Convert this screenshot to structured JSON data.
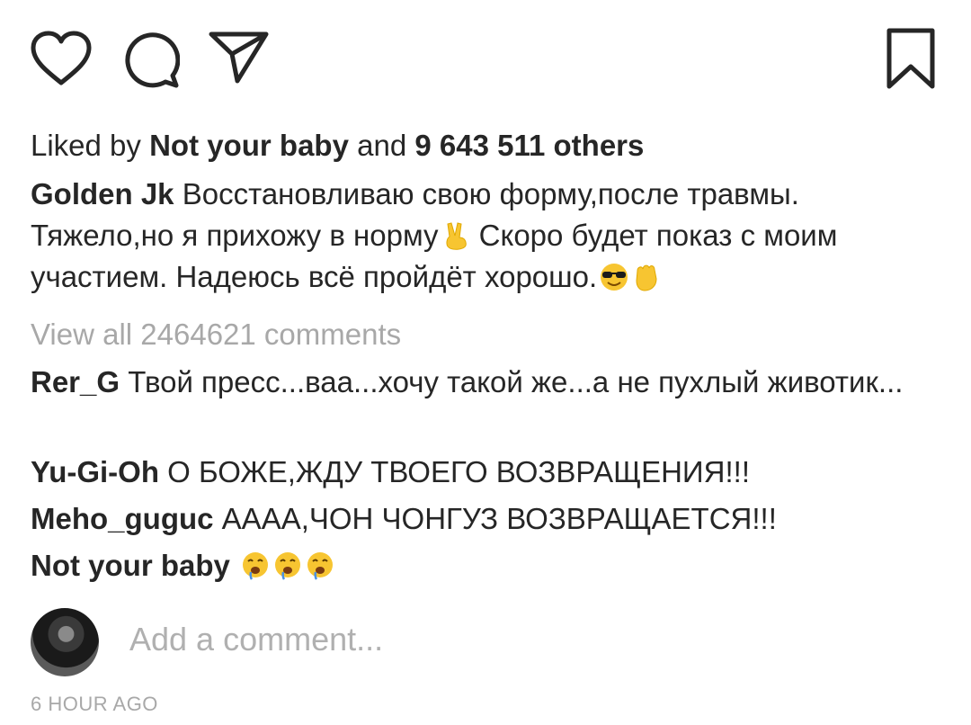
{
  "actions": {
    "like_icon": "heart-icon",
    "comment_icon": "speech-bubble-icon",
    "share_icon": "paper-plane-icon",
    "save_icon": "bookmark-icon"
  },
  "likes": {
    "prefix": "Liked by ",
    "user": "Not your baby",
    "middle": " and ",
    "count": "9 643 511 others"
  },
  "caption": {
    "author": "Golden Jk",
    "text_part1": " Восстановливаю свою форму,после травмы. Тяжело,но я прихожу в норму",
    "emoji1": "victory-hand",
    "text_part2": " Скоро будет показ с моим участием. Надеюсь всё пройдёт хорошо.",
    "emoji2": "sunglasses-face",
    "emoji3": "raised-fist"
  },
  "view_all": "View all 2464621 comments",
  "comments": [
    {
      "user": "Rer_G",
      "text": " Твой пресс...ваа...хочу такой же...а не пухлый животик..."
    },
    {
      "user": "Yu-Gi-Oh",
      "text": " О БОЖЕ,ЖДУ ТВОЕГО ВОЗВРАЩЕНИЯ!!!"
    },
    {
      "user": "Meho_guguc",
      "text": " АААА,ЧОН ЧОНГУЗ ВОЗВРАЩАЕТСЯ!!!"
    },
    {
      "user": "Not your baby",
      "text": " ",
      "emojis": [
        "drooling-face",
        "drooling-face",
        "drooling-face"
      ]
    }
  ],
  "add_comment": {
    "placeholder": "Add a comment..."
  },
  "timestamp": "6 HOUR AGO",
  "colors": {
    "text": "#262626",
    "muted": "#a8a8a8",
    "emoji_yellow": "#f7c531"
  }
}
